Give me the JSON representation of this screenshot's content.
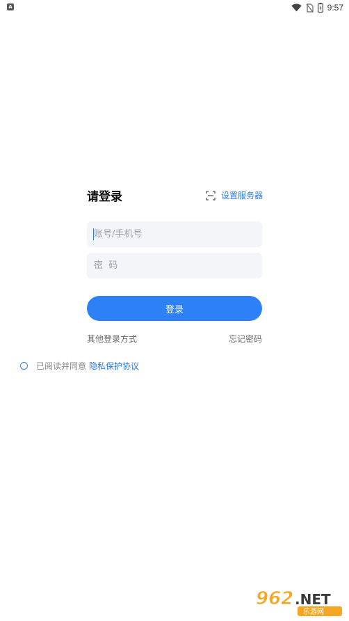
{
  "status_bar": {
    "app_icon": "A",
    "time": "9:57",
    "icons": [
      "wifi-icon",
      "no-sim-icon",
      "battery-icon"
    ]
  },
  "login": {
    "title": "请登录",
    "server_settings_label": "设置服务器",
    "server_settings_icon": "scan-icon",
    "account_placeholder": "账号/手机号",
    "password_placeholder": "密  码",
    "login_button": "登录",
    "other_login": "其他登录方式",
    "forgot_password": "忘记密码"
  },
  "agreement": {
    "prefix": "已阅读并同意",
    "link": "隐私保护协议",
    "checked": false
  },
  "watermark": {
    "brand": "962.NET",
    "subtitle": "乐游网"
  },
  "colors": {
    "accent": "#2e80f6",
    "link": "#2c7be5",
    "field_bg": "#f4f5f8"
  }
}
